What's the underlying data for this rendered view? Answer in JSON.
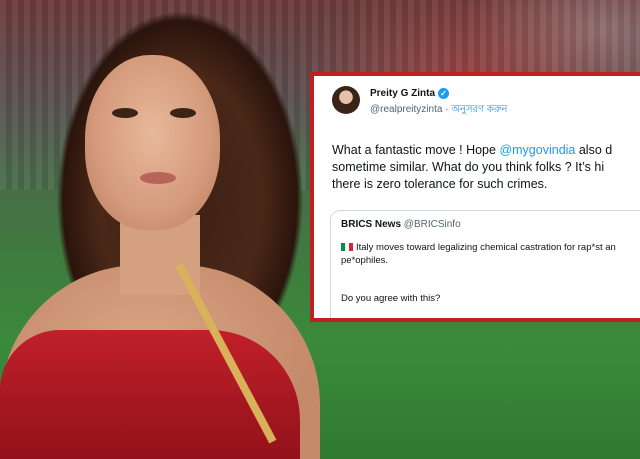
{
  "tweet": {
    "author_name": "Preity G Zinta",
    "handle": "@realpreityzinta",
    "follow_label": "অনুসরণ করুন",
    "line1_pre": "What a fantastic move ! Hope ",
    "mention": "@mygovindia",
    "line1_post": " also d",
    "line2": "sometime similar.  What do you think folks ? It’s hi",
    "line3": "there is zero tolerance for such crimes."
  },
  "quoted": {
    "author_name": "BRICS News",
    "handle": "@BRICSinfo",
    "line1": "Italy moves toward legalizing chemical castration for rap*st an",
    "line2": "pe*ophiles.",
    "question": "Do you agree with this?"
  },
  "colors": {
    "card_border": "#c2201f",
    "mention": "#1d9bf0",
    "dress": "#c0202a"
  },
  "icons": [
    "verified-badge-icon",
    "italy-flag-icon"
  ]
}
